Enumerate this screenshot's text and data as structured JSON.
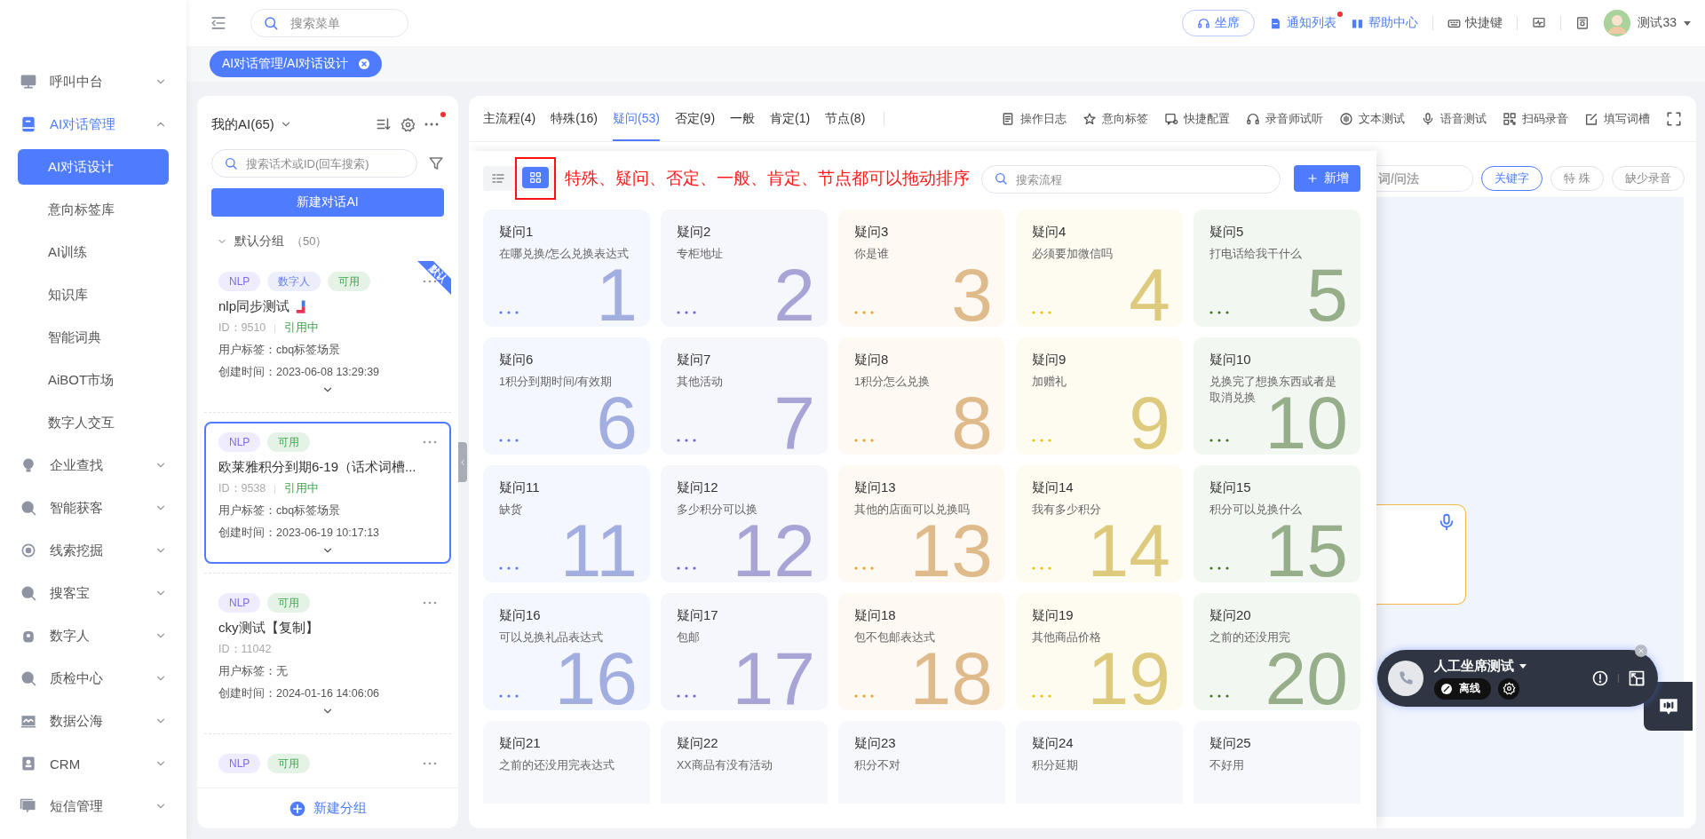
{
  "sidebar": {
    "items": [
      {
        "label": "呼叫中台",
        "expanded": false,
        "selected": false
      },
      {
        "label": "AI对话管理",
        "expanded": true,
        "selected": true,
        "children": [
          {
            "label": "AI对话设计",
            "selected": true
          },
          {
            "label": "意向标签库",
            "selected": false
          },
          {
            "label": "AI训练",
            "selected": false
          },
          {
            "label": "知识库",
            "selected": false
          },
          {
            "label": "智能词典",
            "selected": false
          },
          {
            "label": "AiBOT市场",
            "selected": false
          },
          {
            "label": "数字人交互",
            "selected": false
          }
        ]
      },
      {
        "label": "企业查找",
        "expanded": false,
        "selected": false
      },
      {
        "label": "智能获客",
        "expanded": false,
        "selected": false
      },
      {
        "label": "线索挖掘",
        "expanded": false,
        "selected": false
      },
      {
        "label": "搜客宝",
        "expanded": false,
        "selected": false
      },
      {
        "label": "数字人",
        "expanded": false,
        "selected": false
      },
      {
        "label": "质检中心",
        "expanded": false,
        "selected": false
      },
      {
        "label": "数据公海",
        "expanded": false,
        "selected": false
      },
      {
        "label": "CRM",
        "expanded": false,
        "selected": false
      },
      {
        "label": "短信管理",
        "expanded": false,
        "selected": false
      }
    ]
  },
  "header": {
    "menu_search": {
      "placeholder": "搜索菜单"
    },
    "actions": [
      {
        "label": "坐席",
        "unread": false
      },
      {
        "label": "通知列表",
        "unread": true
      },
      {
        "label": "帮助中心",
        "unread": false
      },
      {
        "label": "快捷键",
        "unread": false
      }
    ],
    "user": {
      "name": "测试33"
    }
  },
  "tag_bar": {
    "tabs": [
      {
        "label": "AI对话管理/AI对话设计",
        "selected": true
      }
    ]
  },
  "ai_list": {
    "title": "我的AI(65)",
    "notification": true,
    "search": {
      "placeholder": "搜索话术或ID(回车搜索)"
    },
    "create_button": "新建对话AI",
    "group": {
      "name": "默认分组",
      "count": "（50）",
      "expanded": true
    },
    "items": [
      {
        "tags": [
          {
            "label": "NLP",
            "color": "#7b6cf6"
          },
          {
            "label": "数字人",
            "color": "#6a7fe8"
          },
          {
            "label": "可用",
            "color": "#3aa54a"
          }
        ],
        "title": "nlp同步测试",
        "decorated": true,
        "id": "ID：9510",
        "status": "引用中",
        "user_tag": "用户标签：cbq标签场景",
        "created": "创建时间：2023-06-08 13:29:39",
        "default": true,
        "default_label": "默认",
        "selected": false
      },
      {
        "tags": [
          {
            "label": "NLP",
            "color": "#7b6cf6"
          },
          {
            "label": "可用",
            "color": "#3aa54a"
          }
        ],
        "title": "欧莱雅积分到期6-19（话术词槽...",
        "decorated": false,
        "id": "ID：9538",
        "status": "引用中",
        "user_tag": "用户标签：cbq标签场景",
        "created": "创建时间：2023-06-19 10:17:13",
        "default": false,
        "selected": true
      },
      {
        "tags": [
          {
            "label": "NLP",
            "color": "#7b6cf6"
          },
          {
            "label": "可用",
            "color": "#3aa54a"
          }
        ],
        "title": "cky测试【复制】",
        "decorated": false,
        "id": "ID：11042",
        "user_tag": "用户标签：无",
        "created": "创建时间：2024-01-16 14:06:06",
        "default": false,
        "selected": false
      },
      {
        "tags": [
          {
            "label": "NLP",
            "color": "#7b6cf6"
          },
          {
            "label": "可用",
            "color": "#3aa54a"
          }
        ],
        "selected": false
      }
    ],
    "footer_button": "新建分组"
  },
  "workspace": {
    "tabs": [
      {
        "label": "主流程(4)",
        "selected": false
      },
      {
        "label": "特殊(16)",
        "selected": false
      },
      {
        "label": "疑问(53)",
        "selected": true
      },
      {
        "label": "否定(9)",
        "selected": false
      },
      {
        "label": "一般",
        "selected": false
      },
      {
        "label": "肯定(1)",
        "selected": false
      },
      {
        "label": "节点(8)",
        "selected": false
      }
    ],
    "tools": [
      {
        "label": "操作日志"
      },
      {
        "label": "意向标签"
      },
      {
        "label": "快捷配置"
      },
      {
        "label": "录音师试听"
      },
      {
        "label": "文本测试"
      },
      {
        "label": "语音测试"
      },
      {
        "label": "扫码录音"
      },
      {
        "label": "填写词槽"
      }
    ]
  },
  "background_panel": {
    "search": {
      "placeholder": "词/问法"
    },
    "filters": [
      {
        "label": "关键字",
        "selected": true
      },
      {
        "label": "特 殊",
        "selected": false
      },
      {
        "label": "缺少录音",
        "selected": false
      }
    ]
  },
  "flow_panel": {
    "view_modes": [
      {
        "kind": "list",
        "selected": false
      },
      {
        "kind": "grid",
        "selected": true
      }
    ],
    "annotation": "特殊、疑问、否定、一般、肯定、节点都可以拖动排序",
    "search": {
      "placeholder": "搜索流程"
    },
    "add_button": "新增",
    "cards": [
      {
        "title": "疑问1",
        "text": "在哪兑换/怎么兑换表达式",
        "number": "1",
        "color": "#5b7cf5"
      },
      {
        "title": "疑问2",
        "text": "专柜地址",
        "number": "2",
        "color": "#6c63e0"
      },
      {
        "title": "疑问3",
        "text": "你是谁",
        "number": "3",
        "color": "#f59a23"
      },
      {
        "title": "疑问4",
        "text": "必须要加微信吗",
        "number": "4",
        "color": "#f2c200"
      },
      {
        "title": "疑问5",
        "text": "打电话给我干什么",
        "number": "5",
        "color": "#3f7a1e"
      },
      {
        "title": "疑问6",
        "text": "1积分到期时间/有效期",
        "number": "6",
        "color": "#5b7cf5"
      },
      {
        "title": "疑问7",
        "text": "其他活动",
        "number": "7",
        "color": "#6c63e0"
      },
      {
        "title": "疑问8",
        "text": "1积分怎么兑换",
        "number": "8",
        "color": "#f59a23"
      },
      {
        "title": "疑问9",
        "text": "加赠礼",
        "number": "9",
        "color": "#f2c200"
      },
      {
        "title": "疑问10",
        "text": "兑换完了想换东西或者是取消兑换",
        "number": "10",
        "color": "#3f7a1e"
      },
      {
        "title": "疑问11",
        "text": "缺货",
        "number": "11",
        "color": "#5b7cf5"
      },
      {
        "title": "疑问12",
        "text": "多少积分可以换",
        "number": "12",
        "color": "#6c63e0"
      },
      {
        "title": "疑问13",
        "text": "其他的店面可以兑换吗",
        "number": "13",
        "color": "#f59a23"
      },
      {
        "title": "疑问14",
        "text": "我有多少积分",
        "number": "14",
        "color": "#f2c200"
      },
      {
        "title": "疑问15",
        "text": "积分可以兑换什么",
        "number": "15",
        "color": "#3f7a1e"
      },
      {
        "title": "疑问16",
        "text": "可以兑换礼品表达式",
        "number": "16",
        "color": "#5b7cf5"
      },
      {
        "title": "疑问17",
        "text": "包邮",
        "number": "17",
        "color": "#6c63e0"
      },
      {
        "title": "疑问18",
        "text": "包不包邮表达式",
        "number": "18",
        "color": "#f59a23"
      },
      {
        "title": "疑问19",
        "text": "其他商品价格",
        "number": "19",
        "color": "#f2c200"
      },
      {
        "title": "疑问20",
        "text": "之前的还没用完",
        "number": "20",
        "color": "#3f7a1e"
      },
      {
        "title": "疑问21",
        "text": "之前的还没用完表达式"
      },
      {
        "title": "疑问22",
        "text": "XX商品有没有活动"
      },
      {
        "title": "疑问23",
        "text": "积分不对"
      },
      {
        "title": "疑问24",
        "text": "积分延期"
      },
      {
        "title": "疑问25",
        "text": "不好用"
      }
    ]
  },
  "phone_widget": {
    "name": "人工坐席测试",
    "status": "离线"
  }
}
